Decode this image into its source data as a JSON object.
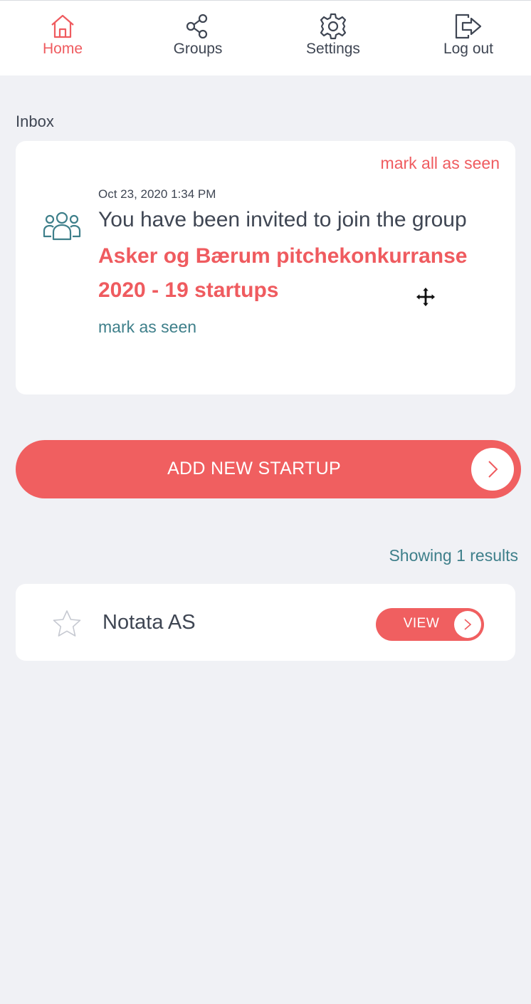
{
  "nav": {
    "home": {
      "label": "Home",
      "icon": "home-icon",
      "active": true
    },
    "groups": {
      "label": "Groups",
      "icon": "share-icon"
    },
    "settings": {
      "label": "Settings",
      "icon": "gear-icon"
    },
    "logout": {
      "label": "Log out",
      "icon": "logout-icon"
    }
  },
  "inbox": {
    "title": "Inbox",
    "mark_all_label": "mark all as seen",
    "notifications": [
      {
        "date": "Oct 23, 2020 1:34 PM",
        "text": "You have been invited to join the group",
        "group_name": "Asker og Bærum pitchekonkurranse 2020 - 19 startups",
        "mark_seen_label": "mark as seen",
        "icon": "users-icon"
      }
    ]
  },
  "add_startup": {
    "label": "ADD NEW STARTUP",
    "icon": "chevron-right-icon"
  },
  "results": {
    "text": "Showing 1 results"
  },
  "startups": [
    {
      "name": "Notata AS",
      "starred": false,
      "view_label": "VIEW"
    }
  ],
  "colors": {
    "accent": "#ef5b5f",
    "teal": "#3e7f8a",
    "text": "#3f4653",
    "background": "#f0f1f5"
  }
}
